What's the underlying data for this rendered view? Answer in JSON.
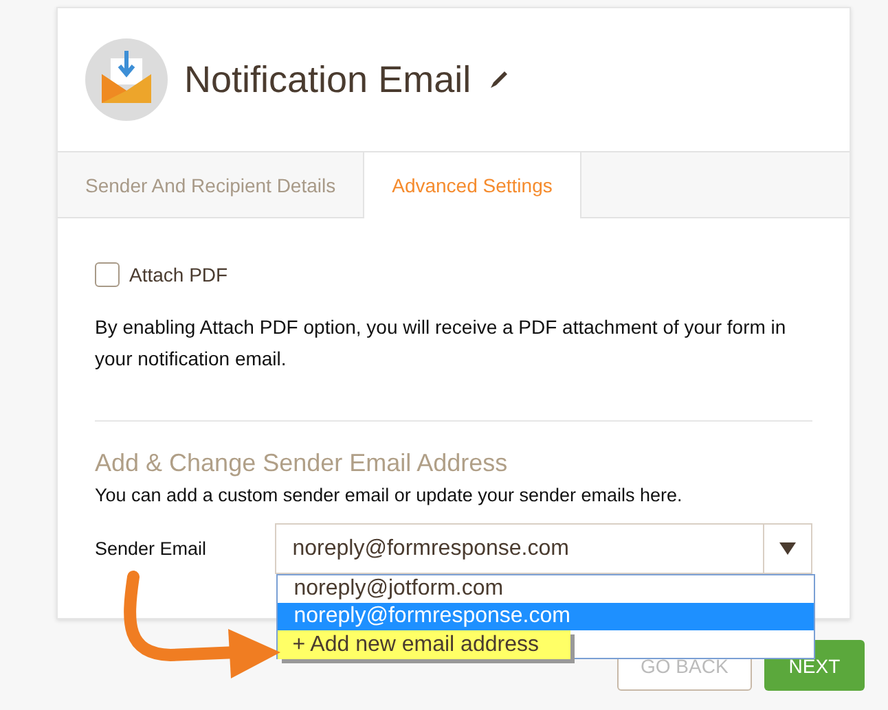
{
  "header": {
    "title": "Notification Email"
  },
  "tabs": [
    {
      "label": "Sender And Recipient Details",
      "selected": false
    },
    {
      "label": "Advanced Settings",
      "selected": true
    }
  ],
  "attach_pdf": {
    "label": "Attach PDF",
    "checked": false,
    "description": "By enabling Attach PDF option, you will receive a PDF attachment of your form in your notification email."
  },
  "sender_section": {
    "heading": "Add & Change Sender Email Address",
    "description": "You can add a custom sender email or update your sender emails here.",
    "field_label": "Sender Email",
    "value": "noreply@formresponse.com",
    "options": [
      {
        "label": "noreply@jotform.com",
        "selected": false,
        "kind": "email"
      },
      {
        "label": "noreply@formresponse.com",
        "selected": true,
        "kind": "email"
      },
      {
        "label": "+ Add new email address",
        "selected": false,
        "kind": "add"
      }
    ]
  },
  "buttons": [
    {
      "label": "GO BACK",
      "kind": "secondary"
    },
    {
      "label": "NEXT",
      "kind": "primary"
    }
  ]
}
